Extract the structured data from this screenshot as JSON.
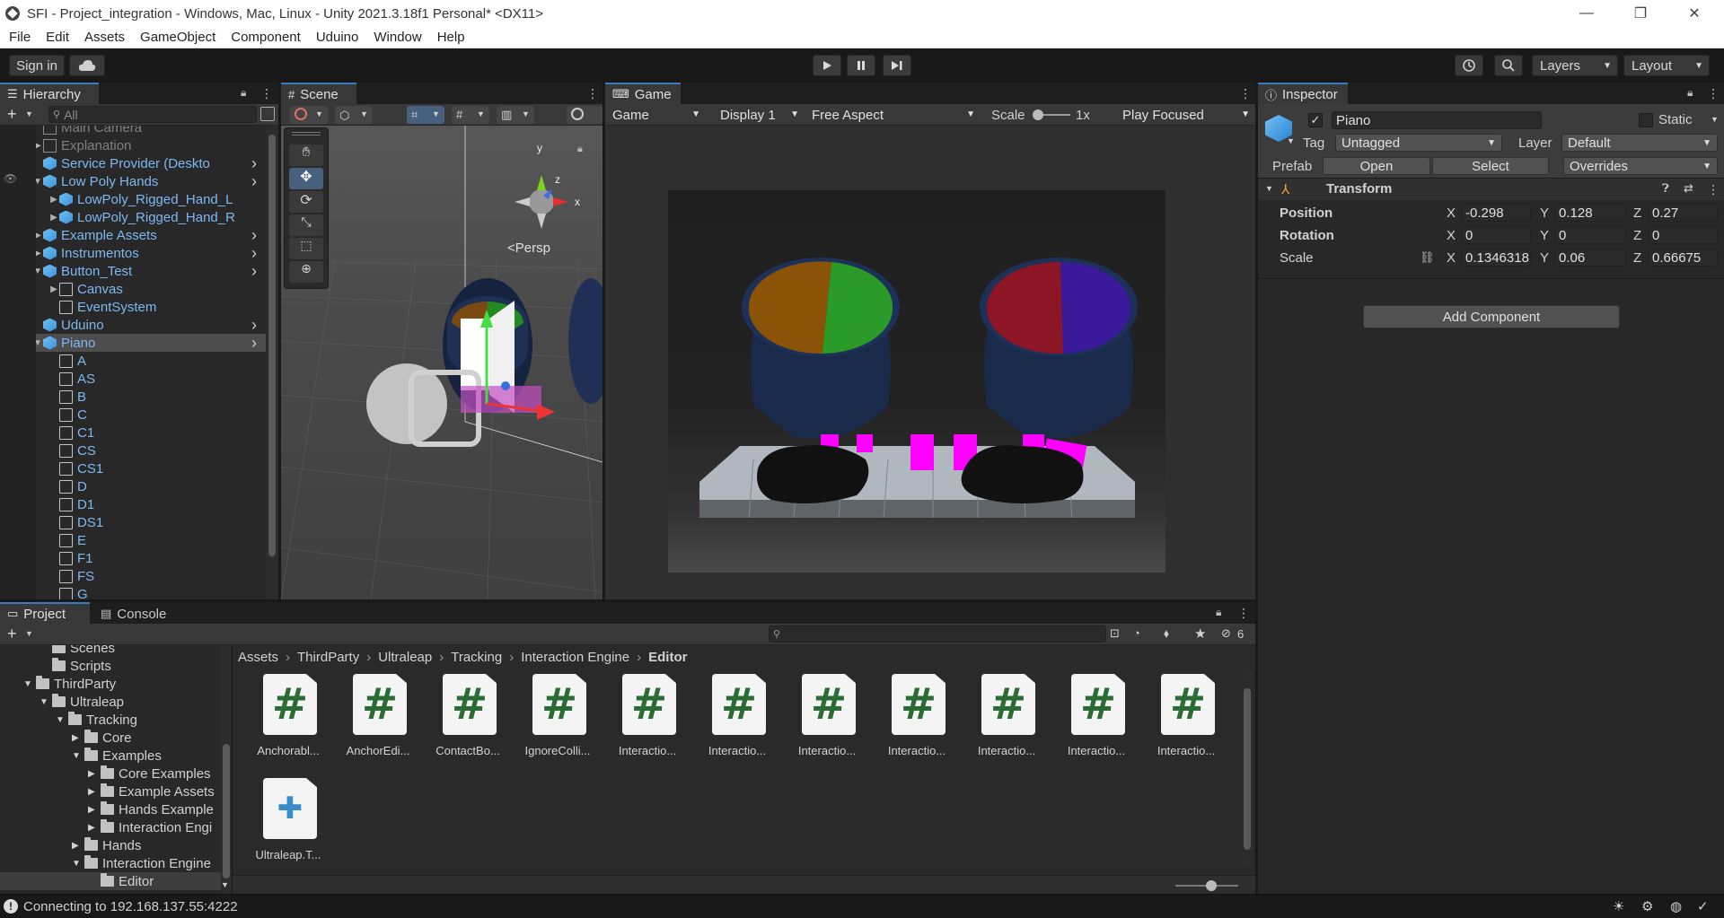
{
  "window": {
    "title": "SFI - Project_integration - Windows, Mac, Linux - Unity 2021.3.18f1 Personal* <DX11>"
  },
  "menu": [
    "File",
    "Edit",
    "Assets",
    "GameObject",
    "Component",
    "Uduino",
    "Window",
    "Help"
  ],
  "toolbar": {
    "sign_in": "Sign in",
    "layers": "Layers",
    "layout": "Layout"
  },
  "hierarchy": {
    "tab": "Hierarchy",
    "search_placeholder": "All",
    "items": [
      {
        "label": "Main Camera",
        "depth": 1,
        "style": "gray",
        "arrow": ""
      },
      {
        "label": "Explanation",
        "depth": 1,
        "style": "gray",
        "arrow": "▶"
      },
      {
        "label": "Service Provider (Deskto",
        "depth": 1,
        "style": "blue",
        "arrow": ""
      },
      {
        "label": "Low Poly Hands",
        "depth": 1,
        "style": "blue",
        "arrow": "▼"
      },
      {
        "label": "LowPoly_Rigged_Hand_L",
        "depth": 2,
        "style": "blue",
        "arrow": "▶"
      },
      {
        "label": "LowPoly_Rigged_Hand_R",
        "depth": 2,
        "style": "blue",
        "arrow": "▶"
      },
      {
        "label": "Example Assets",
        "depth": 1,
        "style": "blue",
        "arrow": "▶"
      },
      {
        "label": "Instrumentos",
        "depth": 1,
        "style": "blue",
        "arrow": "▶"
      },
      {
        "label": "Button_Test",
        "depth": 1,
        "style": "blue",
        "arrow": "▼"
      },
      {
        "label": "Canvas",
        "depth": 2,
        "style": "outline-blue",
        "arrow": "▶"
      },
      {
        "label": "EventSystem",
        "depth": 2,
        "style": "outline-blue",
        "arrow": ""
      },
      {
        "label": "Uduino",
        "depth": 1,
        "style": "blue",
        "arrow": ""
      },
      {
        "label": "Piano",
        "depth": 1,
        "style": "blue-selected",
        "arrow": "▼"
      },
      {
        "label": "A",
        "depth": 2,
        "style": "outline-blue",
        "arrow": ""
      },
      {
        "label": "AS",
        "depth": 2,
        "style": "outline-blue",
        "arrow": ""
      },
      {
        "label": "B",
        "depth": 2,
        "style": "outline-blue",
        "arrow": ""
      },
      {
        "label": "C",
        "depth": 2,
        "style": "outline-blue",
        "arrow": ""
      },
      {
        "label": "C1",
        "depth": 2,
        "style": "outline-blue",
        "arrow": ""
      },
      {
        "label": "CS",
        "depth": 2,
        "style": "outline-blue",
        "arrow": ""
      },
      {
        "label": "CS1",
        "depth": 2,
        "style": "outline-blue",
        "arrow": ""
      },
      {
        "label": "D",
        "depth": 2,
        "style": "outline-blue",
        "arrow": ""
      },
      {
        "label": "D1",
        "depth": 2,
        "style": "outline-blue",
        "arrow": ""
      },
      {
        "label": "DS1",
        "depth": 2,
        "style": "outline-blue",
        "arrow": ""
      },
      {
        "label": "E",
        "depth": 2,
        "style": "outline-blue",
        "arrow": ""
      },
      {
        "label": "F1",
        "depth": 2,
        "style": "outline-blue",
        "arrow": ""
      },
      {
        "label": "FS",
        "depth": 2,
        "style": "outline-blue",
        "arrow": ""
      },
      {
        "label": "G",
        "depth": 2,
        "style": "outline-blue",
        "arrow": ""
      }
    ]
  },
  "scene": {
    "tab": "Scene",
    "persp": "<Persp",
    "axis_y": "y",
    "axis_x": "x",
    "axis_z": "z"
  },
  "game": {
    "tab": "Game",
    "mode": "Game",
    "display": "Display 1",
    "aspect": "Free Aspect",
    "scale_label": "Scale",
    "scale_value": "1x",
    "play_focused": "Play Focused"
  },
  "inspector": {
    "tab": "Inspector",
    "object_name": "Piano",
    "static_label": "Static",
    "tag_label": "Tag",
    "tag_value": "Untagged",
    "layer_label": "Layer",
    "layer_value": "Default",
    "prefab_label": "Prefab",
    "prefab_open": "Open",
    "prefab_select": "Select",
    "prefab_overrides": "Overrides",
    "transform_title": "Transform",
    "position_label": "Position",
    "rotation_label": "Rotation",
    "scale_label": "Scale",
    "position": {
      "x": "-0.298",
      "y": "0.128",
      "z": "0.27"
    },
    "rotation": {
      "x": "0",
      "y": "0",
      "z": "0"
    },
    "scale": {
      "x": "0.1346318",
      "y": "0.06",
      "z": "0.66675"
    },
    "axis_x": "X",
    "axis_y": "Y",
    "axis_z": "Z",
    "add_component": "Add Component"
  },
  "project": {
    "tab_project": "Project",
    "tab_console": "Console",
    "hidden_count": "6",
    "breadcrumb": [
      "Assets",
      "ThirdParty",
      "Ultraleap",
      "Tracking",
      "Interaction Engine",
      "Editor"
    ],
    "tree": [
      {
        "label": "Scenes",
        "depth": 1,
        "arrow": ""
      },
      {
        "label": "Scripts",
        "depth": 1,
        "arrow": ""
      },
      {
        "label": "ThirdParty",
        "depth": 0,
        "arrow": "▼"
      },
      {
        "label": "Ultraleap",
        "depth": 1,
        "arrow": "▼"
      },
      {
        "label": "Tracking",
        "depth": 2,
        "arrow": "▼"
      },
      {
        "label": "Core",
        "depth": 3,
        "arrow": "▶"
      },
      {
        "label": "Examples",
        "depth": 3,
        "arrow": "▼"
      },
      {
        "label": "Core Examples",
        "depth": 4,
        "arrow": "▶"
      },
      {
        "label": "Example Assets",
        "depth": 4,
        "arrow": "▶"
      },
      {
        "label": "Hands Example",
        "depth": 4,
        "arrow": "▶"
      },
      {
        "label": "Interaction Engi",
        "depth": 4,
        "arrow": "▶"
      },
      {
        "label": "Hands",
        "depth": 3,
        "arrow": "▶"
      },
      {
        "label": "Interaction Engine",
        "depth": 3,
        "arrow": "▼"
      },
      {
        "label": "Editor",
        "depth": 4,
        "arrow": ""
      }
    ],
    "assets": [
      {
        "label": "Anchorabl...",
        "kind": "script"
      },
      {
        "label": "AnchorEdi...",
        "kind": "script"
      },
      {
        "label": "ContactBo...",
        "kind": "script"
      },
      {
        "label": "IgnoreColli...",
        "kind": "script"
      },
      {
        "label": "Interactio...",
        "kind": "script"
      },
      {
        "label": "Interactio...",
        "kind": "script"
      },
      {
        "label": "Interactio...",
        "kind": "script"
      },
      {
        "label": "Interactio...",
        "kind": "script"
      },
      {
        "label": "Interactio...",
        "kind": "script"
      },
      {
        "label": "Interactio...",
        "kind": "script"
      },
      {
        "label": "Interactio...",
        "kind": "script"
      },
      {
        "label": "Ultraleap.T...",
        "kind": "asmdef"
      }
    ]
  },
  "status": {
    "message": "Connecting to 192.168.137.55:4222"
  },
  "colors": {
    "accent": "#3a79bb",
    "selection": "#4d4d4d",
    "magenta": "#ff00ff"
  }
}
